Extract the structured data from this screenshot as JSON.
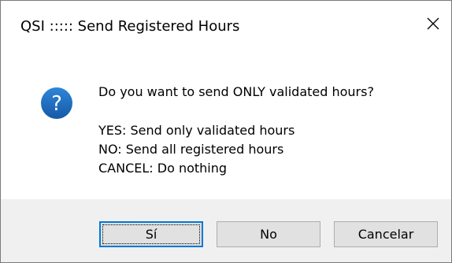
{
  "window": {
    "title": "QSI ::::: Send Registered Hours",
    "close_icon": "close-icon"
  },
  "message": {
    "icon": "question-icon",
    "icon_glyph": "?",
    "icon_color": "#1e6fc1",
    "question": "Do you want to send ONLY validated hours?",
    "lines": [
      "YES: Send only validated hours",
      "NO: Send all registered hours",
      "CANCEL: Do nothing"
    ]
  },
  "buttons": {
    "yes_label": "Sí",
    "no_label": "No",
    "cancel_label": "Cancelar"
  },
  "colors": {
    "footer_bg": "#f0f0f0",
    "button_bg": "#e1e1e1",
    "default_button_border": "#0078d7"
  }
}
